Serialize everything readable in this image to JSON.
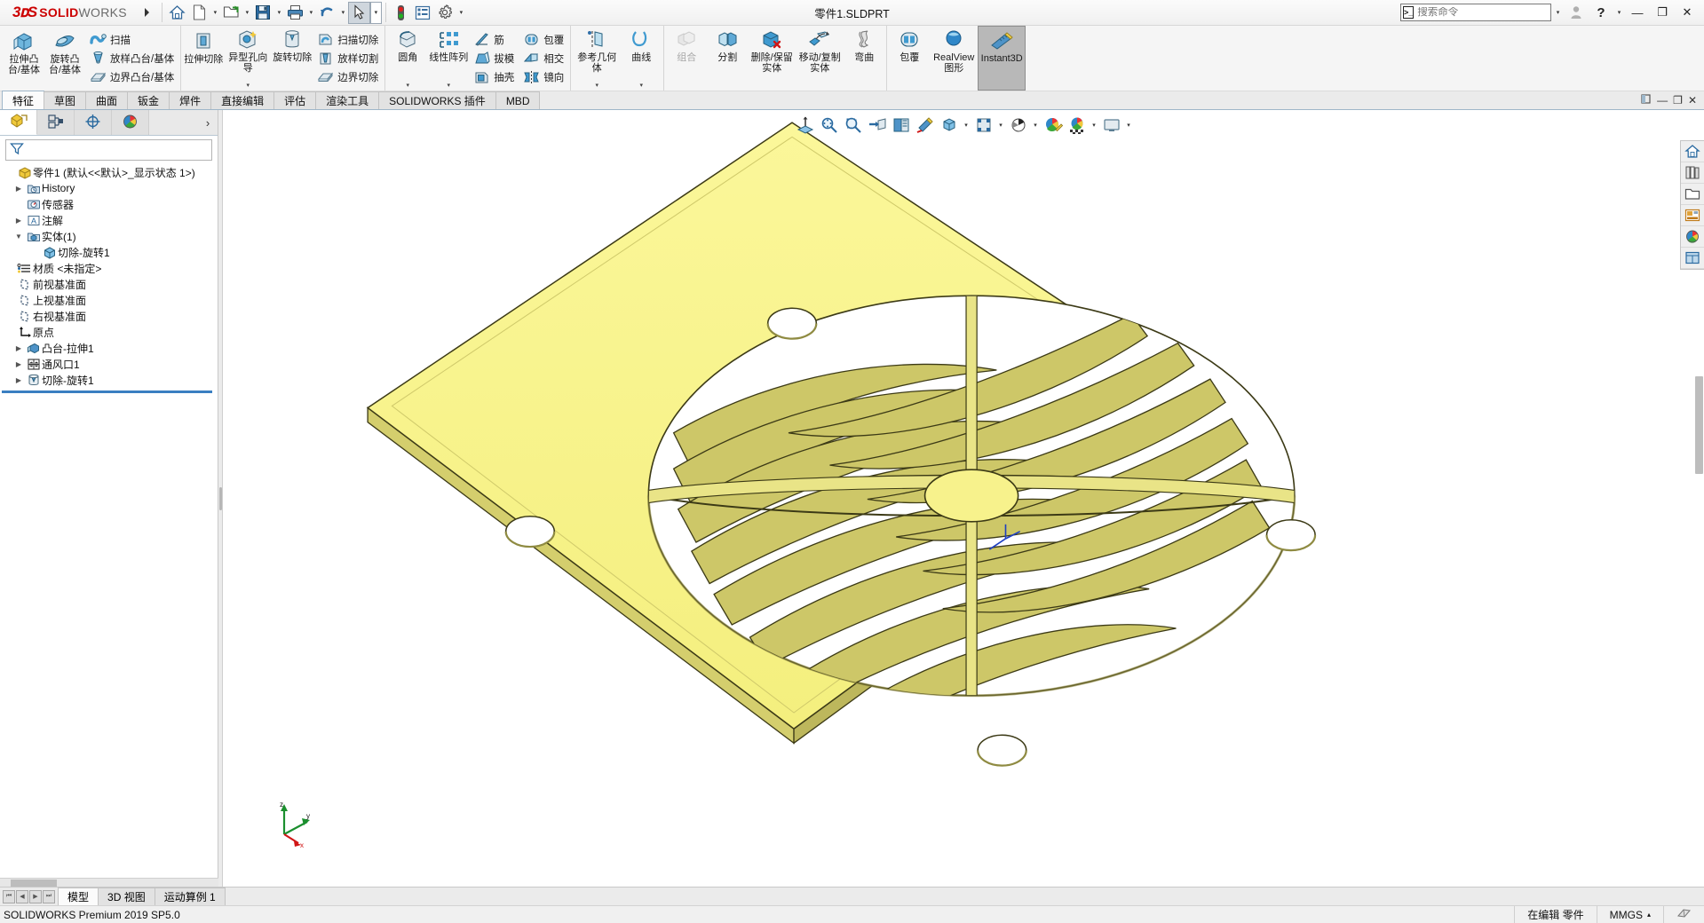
{
  "titlebar": {
    "logo_ds": "3DS",
    "logo_solid": "SOLID",
    "logo_works": "WORKS",
    "document_title": "零件1.SLDPRT",
    "quick_access": [
      {
        "name": "home-icon",
        "label": "主页"
      },
      {
        "name": "new-document-icon",
        "label": "新建"
      },
      {
        "name": "open-folder-icon",
        "label": "打开"
      },
      {
        "name": "save-icon",
        "label": "保存"
      },
      {
        "name": "print-icon",
        "label": "打印"
      },
      {
        "name": "undo-icon",
        "label": "撤销"
      },
      {
        "name": "select-cursor-icon",
        "label": "选择"
      },
      {
        "name": "rebuild-traffic-icon",
        "label": "重建模型"
      },
      {
        "name": "options-list-icon",
        "label": "文件属性"
      },
      {
        "name": "gear-icon",
        "label": "选项"
      }
    ],
    "search": {
      "placeholder": "搜索命令",
      "value": ""
    },
    "user_icon": "user-account-icon",
    "help_icon": "help-icon",
    "window_minimize": "—",
    "window_restore": "❐",
    "window_close": "✕"
  },
  "ribbon": {
    "groups": [
      {
        "name": "features-solids",
        "big": [
          {
            "label": "拉伸凸台/基体",
            "icon": "extruded-boss-icon",
            "dropdown": false
          },
          {
            "label": "旋转凸台/基体",
            "icon": "revolved-boss-icon",
            "dropdown": false
          }
        ],
        "small": [
          {
            "label": "扫描",
            "icon": "swept-boss-icon"
          },
          {
            "label": "放样凸台/基体",
            "icon": "lofted-boss-icon"
          },
          {
            "label": "边界凸台/基体",
            "icon": "boundary-boss-icon"
          }
        ]
      },
      {
        "name": "features-cuts",
        "big": [
          {
            "label": "拉伸切除",
            "icon": "extruded-cut-icon",
            "dropdown": false
          },
          {
            "label": "异型孔向导",
            "icon": "hole-wizard-icon",
            "dropdown": true
          },
          {
            "label": "旋转切除",
            "icon": "revolved-cut-icon",
            "dropdown": false
          }
        ],
        "small": [
          {
            "label": "扫描切除",
            "icon": "swept-cut-icon"
          },
          {
            "label": "放样切割",
            "icon": "lofted-cut-icon"
          },
          {
            "label": "边界切除",
            "icon": "boundary-cut-icon"
          }
        ]
      },
      {
        "name": "features-modify",
        "big": [
          {
            "label": "圆角",
            "icon": "fillet-icon",
            "dropdown": true
          },
          {
            "label": "线性阵列",
            "icon": "linear-pattern-icon",
            "dropdown": true
          }
        ],
        "small": [
          {
            "label": "筋",
            "icon": "rib-icon"
          },
          {
            "label": "拔模",
            "icon": "draft-icon"
          },
          {
            "label": "抽壳",
            "icon": "shell-icon"
          }
        ],
        "small2": [
          {
            "label": "包覆",
            "icon": "wrap-icon"
          },
          {
            "label": "相交",
            "icon": "intersect-icon"
          },
          {
            "label": "镜向",
            "icon": "mirror-icon"
          }
        ]
      },
      {
        "name": "reference-geometry",
        "big": [
          {
            "label": "参考几何体",
            "icon": "reference-geometry-icon",
            "dropdown": true
          },
          {
            "label": "曲线",
            "icon": "curves-icon",
            "dropdown": true
          }
        ],
        "small": []
      },
      {
        "name": "bodies",
        "big": [
          {
            "label": "组合",
            "icon": "combine-icon",
            "dropdown": false,
            "disabled": true
          },
          {
            "label": "分割",
            "icon": "split-icon",
            "dropdown": false
          },
          {
            "label": "删除/保留实体",
            "icon": "delete-keep-body-icon",
            "dropdown": false
          },
          {
            "label": "移动/复制实体",
            "icon": "move-copy-body-icon",
            "dropdown": false
          },
          {
            "label": "弯曲",
            "icon": "flex-icon",
            "dropdown": false
          }
        ],
        "small": []
      },
      {
        "name": "display",
        "big": [
          {
            "label": "包覆",
            "icon": "wrap-big-icon",
            "dropdown": false
          },
          {
            "label": "RealView 图形",
            "icon": "realview-icon",
            "dropdown": false
          },
          {
            "label": "Instant3D",
            "icon": "instant3d-icon",
            "dropdown": false,
            "selected": true
          }
        ],
        "small": []
      }
    ]
  },
  "command_tabs": {
    "items": [
      {
        "label": "特征",
        "active": true
      },
      {
        "label": "草图",
        "active": false
      },
      {
        "label": "曲面",
        "active": false
      },
      {
        "label": "钣金",
        "active": false
      },
      {
        "label": "焊件",
        "active": false
      },
      {
        "label": "直接编辑",
        "active": false
      },
      {
        "label": "评估",
        "active": false
      },
      {
        "label": "渲染工具",
        "active": false
      },
      {
        "label": "SOLIDWORKS 插件",
        "active": false
      },
      {
        "label": "MBD",
        "active": false
      }
    ]
  },
  "feature_manager": {
    "tabs": [
      {
        "name": "feature-tree-tab",
        "icon": "feature-tree-icon",
        "active": true
      },
      {
        "name": "property-manager-tab",
        "icon": "property-manager-icon",
        "active": false
      },
      {
        "name": "configuration-manager-tab",
        "icon": "configuration-icon",
        "active": false
      },
      {
        "name": "display-manager-tab",
        "icon": "display-manager-icon",
        "active": false
      }
    ],
    "expand_chevron": "›",
    "filter": {
      "placeholder": "",
      "value": "",
      "icon": "filter-funnel-icon"
    },
    "tree": [
      {
        "label": "零件1  (默认<<默认>_显示状态 1>)",
        "indent": 0,
        "twisty": "",
        "icon": "part-icon"
      },
      {
        "label": "History",
        "indent": 1,
        "twisty": "▶",
        "icon": "history-icon"
      },
      {
        "label": "传感器",
        "indent": 1,
        "twisty": "",
        "icon": "sensor-icon"
      },
      {
        "label": "注解",
        "indent": 1,
        "twisty": "▶",
        "icon": "annotations-icon"
      },
      {
        "label": "实体(1)",
        "indent": 1,
        "twisty": "▼",
        "icon": "solid-bodies-icon"
      },
      {
        "label": "切除-旋转1",
        "indent": 2,
        "twisty": "",
        "icon": "body-icon"
      },
      {
        "label": "材质 <未指定>",
        "indent": 1,
        "twisty": "",
        "icon": "material-icon"
      },
      {
        "label": "前视基准面",
        "indent": 1,
        "twisty": "",
        "icon": "plane-icon"
      },
      {
        "label": "上视基准面",
        "indent": 1,
        "twisty": "",
        "icon": "plane-icon"
      },
      {
        "label": "右视基准面",
        "indent": 1,
        "twisty": "",
        "icon": "plane-icon"
      },
      {
        "label": "原点",
        "indent": 1,
        "twisty": "",
        "icon": "origin-icon"
      },
      {
        "label": "凸台-拉伸1",
        "indent": 1,
        "twisty": "▶",
        "icon": "extrude-feature-icon"
      },
      {
        "label": "通风口1",
        "indent": 1,
        "twisty": "▶",
        "icon": "vent-icon"
      },
      {
        "label": "切除-旋转1",
        "indent": 1,
        "twisty": "▶",
        "icon": "revolve-cut-feature-icon"
      }
    ]
  },
  "heads_up_toolbar": {
    "items": [
      {
        "name": "zoom-to-fit-icon",
        "label": "整屏显示全图",
        "caret": false
      },
      {
        "name": "zoom-to-area-icon",
        "label": "局部放大",
        "caret": false
      },
      {
        "name": "previous-view-icon",
        "label": "上一视图",
        "caret": false
      },
      {
        "name": "section-view-icon",
        "label": "剖面视图",
        "caret": false
      },
      {
        "name": "view-orientation-icon",
        "label": "视图定向",
        "caret": false
      },
      {
        "name": "display-style-icon",
        "label": "显示样式",
        "caret": true
      },
      {
        "name": "hide-show-items-icon",
        "label": "隐藏/显示项目",
        "caret": true
      },
      {
        "name": "edit-appearance-icon",
        "label": "编辑外观",
        "caret": true
      },
      {
        "name": "apply-scene-icon",
        "label": "应用布景",
        "caret": true
      },
      {
        "name": "view-settings-icon",
        "label": "视图设定",
        "caret": true
      }
    ]
  },
  "viewport_controls": {
    "pin": "pin-icon",
    "minimize": "—",
    "restore": "❐",
    "close": "✕"
  },
  "right_task_pane": {
    "items": [
      {
        "name": "sw-resources-icon",
        "label": "SOLIDWORKS 资源"
      },
      {
        "name": "design-library-icon",
        "label": "设计库"
      },
      {
        "name": "file-explorer-icon",
        "label": "文件探索器"
      },
      {
        "name": "view-palette-icon",
        "label": "视图调色板"
      },
      {
        "name": "appearances-scenes-icon",
        "label": "外观、布景和贴图"
      },
      {
        "name": "custom-properties-icon",
        "label": "自定义属性"
      }
    ]
  },
  "triad": {
    "z_label": "z",
    "y_label": "y",
    "x_label": "x"
  },
  "bottom_tabs": {
    "nav": [
      "⏮",
      "◀",
      "▶",
      "⏭"
    ],
    "items": [
      {
        "label": "模型",
        "active": true
      },
      {
        "label": "3D 视图",
        "active": false
      },
      {
        "label": "运动算例 1",
        "active": false
      }
    ]
  },
  "status_bar": {
    "left": "SOLIDWORKS Premium 2019 SP5.0",
    "editing": "在编辑 零件",
    "units": "MMGS",
    "units_caret": "▴",
    "overlay_icon": "custom-overlay-icon"
  },
  "colors": {
    "model_fill": "#f7f48a",
    "model_fill_dark": "#cfc96a",
    "model_edge": "#3a3a14",
    "accent_blue": "#3a7fc1",
    "brand_red": "#cc0000"
  }
}
